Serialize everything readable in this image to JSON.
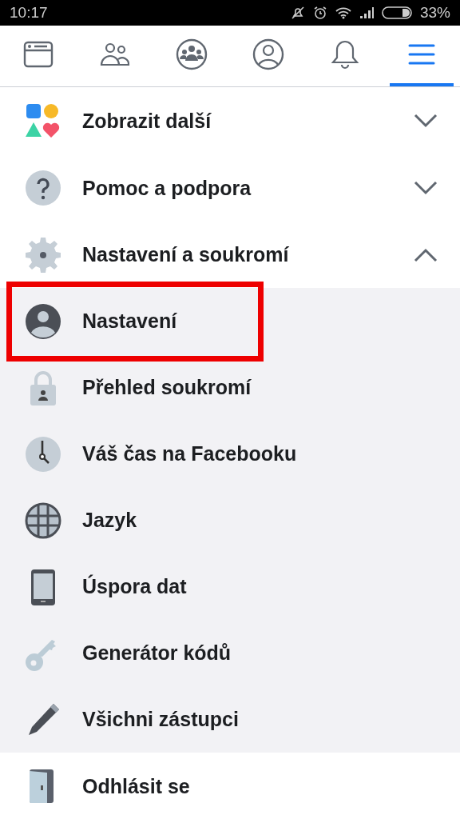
{
  "status_bar": {
    "time": "10:17",
    "battery": "33%"
  },
  "tabs": [
    {
      "selected": false
    },
    {
      "selected": false
    },
    {
      "selected": false
    },
    {
      "selected": false
    },
    {
      "selected": false
    },
    {
      "selected": true
    }
  ],
  "sections": [
    {
      "label": "Zobrazit další",
      "expanded": false
    },
    {
      "label": "Pomoc a podpora",
      "expanded": false
    },
    {
      "label": "Nastavení a soukromí",
      "expanded": true,
      "children": [
        {
          "label": "Nastavení",
          "highlighted": true
        },
        {
          "label": "Přehled soukromí",
          "highlighted": false
        },
        {
          "label": "Váš čas na Facebooku",
          "highlighted": false
        },
        {
          "label": "Jazyk",
          "highlighted": false
        },
        {
          "label": "Úspora dat",
          "highlighted": false
        },
        {
          "label": "Generátor kódů",
          "highlighted": false
        },
        {
          "label": "Všichni zástupci",
          "highlighted": false
        }
      ]
    },
    {
      "label": "Odhlásit se"
    }
  ]
}
